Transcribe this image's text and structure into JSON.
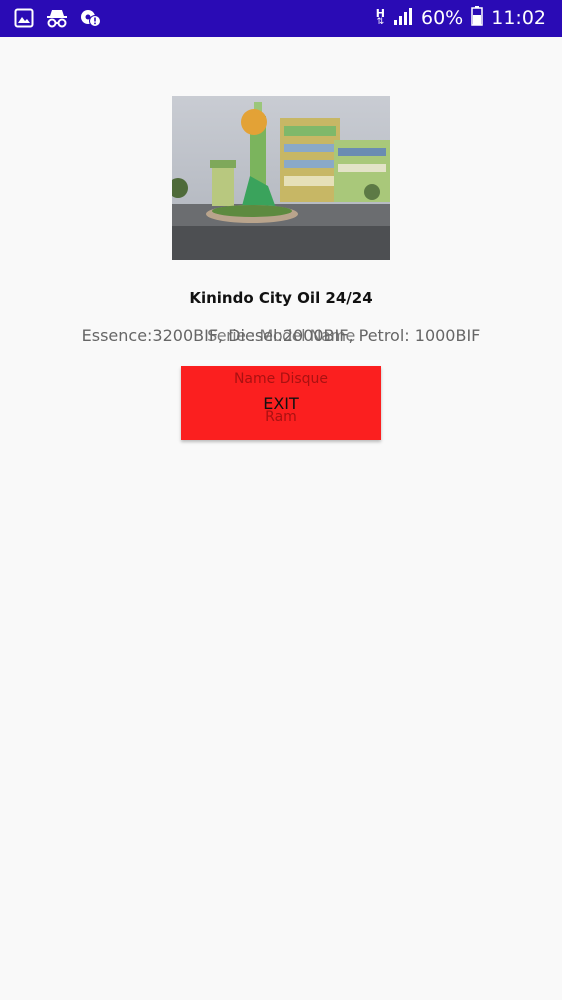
{
  "status_bar": {
    "battery_percent": "60%",
    "time": "11:02",
    "network_type": "H",
    "icons": [
      "gallery-icon",
      "incognito-icon",
      "settings-alert-icon",
      "signal-icon",
      "battery-icon"
    ],
    "background_color": "#2a0bb5"
  },
  "main": {
    "station_name": "Kinindo City Oil 24/24",
    "price_line": "Essence:3200BIF, Diesel:2000BIF, Petrol: 1000BIF",
    "device_info_line": "Serie : Model Name",
    "exit_button": {
      "label": "EXIT",
      "ghost_top": "Name Disque",
      "ghost_bottom": "Ram",
      "color": "#fb1f1f"
    }
  }
}
